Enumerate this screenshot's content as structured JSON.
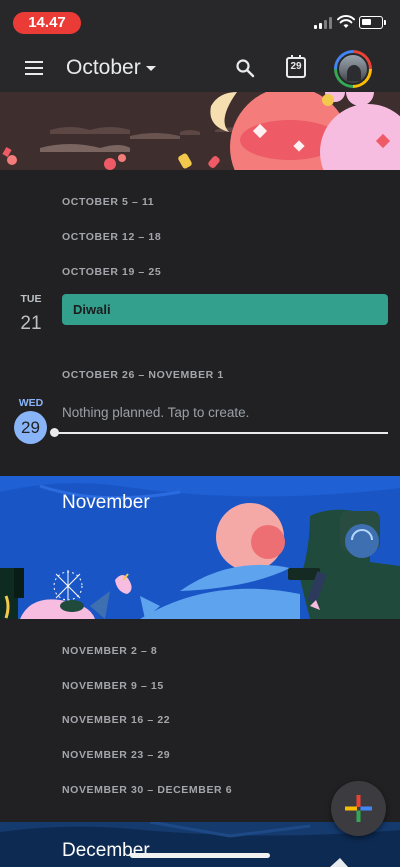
{
  "status_bar": {
    "time": "14.47"
  },
  "app_bar": {
    "month": "October",
    "today_date": "29",
    "icons": [
      "menu-icon",
      "dropdown-icon",
      "search-icon",
      "today-icon",
      "avatar"
    ]
  },
  "weeks_october": [
    {
      "label": "OCTOBER 5 – 11"
    },
    {
      "label": "OCTOBER 12 – 18"
    },
    {
      "label": "OCTOBER 19 – 25"
    }
  ],
  "day_tue": {
    "dow": "TUE",
    "num": "21"
  },
  "event_diwali": {
    "title": "Diwali",
    "color": "#33a08d"
  },
  "week_oct26": {
    "label": "OCTOBER 26 – NOVEMBER 1"
  },
  "day_wed": {
    "dow": "WED",
    "num": "29",
    "placeholder": "Nothing planned. Tap to create."
  },
  "november": {
    "title": "November",
    "weeks": [
      {
        "label": "NOVEMBER 2 – 8"
      },
      {
        "label": "NOVEMBER 9 – 15"
      },
      {
        "label": "NOVEMBER 16 – 22"
      },
      {
        "label": "NOVEMBER 23 – 29"
      },
      {
        "label": "NOVEMBER 30 – DECEMBER 6"
      }
    ]
  },
  "december": {
    "title": "December"
  },
  "fab": {
    "icon": "plus-icon"
  },
  "colors": {
    "background": "#212124",
    "accent_blue": "#8ab4f8",
    "event_green": "#33a08d",
    "status_pill": "#ea3b37"
  }
}
